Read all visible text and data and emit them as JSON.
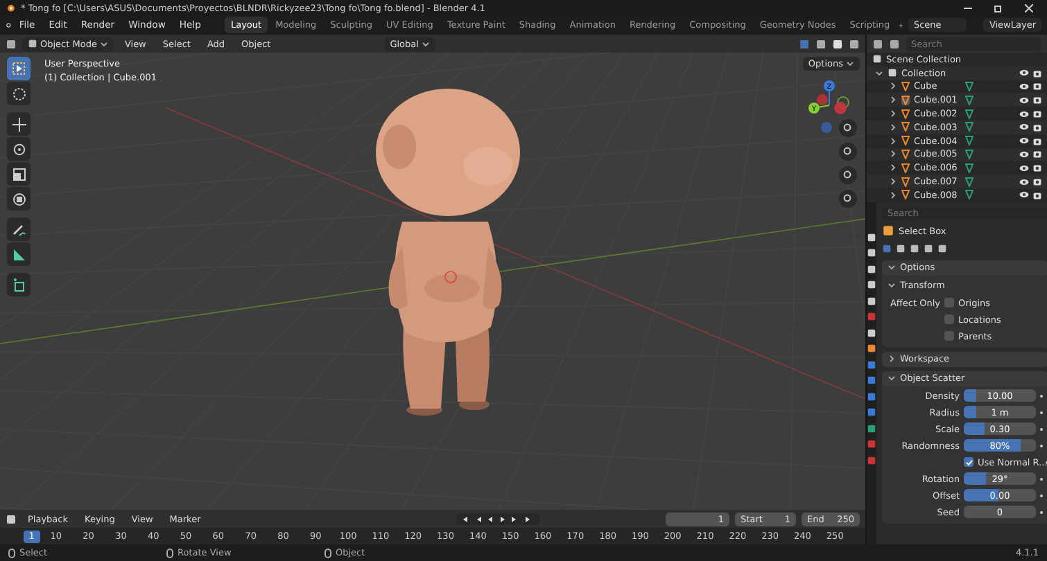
{
  "window": {
    "title": "* Tong fo [C:\\Users\\ASUS\\Documents\\Proyectos\\BLNDR\\Rickyzee23\\Tong fo\\Tong fo.blend] - Blender 4.1"
  },
  "menu": [
    "File",
    "Edit",
    "Render",
    "Window",
    "Help"
  ],
  "workspaces": [
    {
      "label": "Layout",
      "selected": true
    },
    {
      "label": "Modeling",
      "selected": false
    },
    {
      "label": "Sculpting",
      "selected": false
    },
    {
      "label": "UV Editing",
      "selected": false
    },
    {
      "label": "Texture Paint",
      "selected": false
    },
    {
      "label": "Shading",
      "selected": false
    },
    {
      "label": "Animation",
      "selected": false
    },
    {
      "label": "Rendering",
      "selected": false
    },
    {
      "label": "Compositing",
      "selected": false
    },
    {
      "label": "Geometry Nodes",
      "selected": false
    },
    {
      "label": "Scripting",
      "selected": false
    }
  ],
  "scene": "Scene",
  "view_layer": "ViewLayer",
  "viewport_header": {
    "mode": "Object Mode",
    "menus": [
      "View",
      "Select",
      "Add",
      "Object"
    ],
    "orientation": "Global",
    "options": "Options"
  },
  "viewport": {
    "overlay_lines": [
      "User Perspective",
      "(1) Collection | Cube.001"
    ],
    "gizmo_axes": [
      "Z",
      "Y"
    ]
  },
  "outliner": {
    "search_placeholder": "Search",
    "root": "Scene Collection",
    "collection": {
      "name": "Collection",
      "expanded": true,
      "children": [
        {
          "name": "Cube",
          "selected": false
        },
        {
          "name": "Cube.001",
          "selected": true
        },
        {
          "name": "Cube.002",
          "selected": false
        },
        {
          "name": "Cube.003",
          "selected": false
        },
        {
          "name": "Cube.004",
          "selected": false
        },
        {
          "name": "Cube.005",
          "selected": false
        },
        {
          "name": "Cube.006",
          "selected": false
        },
        {
          "name": "Cube.007",
          "selected": false
        },
        {
          "name": "Cube.008",
          "selected": false
        }
      ]
    }
  },
  "properties": {
    "search_placeholder": "Search",
    "tool": "Select Box",
    "options": {
      "title": "Options",
      "expanded": true,
      "transform": {
        "title": "Transform",
        "expanded": true,
        "label": "Affect Only",
        "checkboxes": [
          {
            "label": "Origins",
            "checked": false
          },
          {
            "label": "Locations",
            "checked": false
          },
          {
            "label": "Parents",
            "checked": false
          }
        ]
      }
    },
    "workspace": {
      "title": "Workspace",
      "expanded": false
    },
    "object_scatter": {
      "title": "Object Scatter",
      "expanded": true,
      "fields": [
        {
          "kind": "slider",
          "label": "Density",
          "value": "10.00",
          "level": 0.17
        },
        {
          "kind": "slider",
          "label": "Radius",
          "value": "1 m",
          "level": 0.17
        },
        {
          "kind": "slider",
          "label": "Scale",
          "value": "0.30",
          "level": 0.29
        },
        {
          "kind": "slider",
          "label": "Randomness",
          "value": "80%",
          "level": 0.79
        },
        {
          "kind": "checkbox",
          "label": "Use Normal R...",
          "checked": true
        },
        {
          "kind": "slider",
          "label": "Rotation",
          "value": "29°",
          "level": 0.31
        },
        {
          "kind": "slider",
          "label": "Offset",
          "value": "0.00",
          "level": 0.48
        },
        {
          "kind": "number",
          "label": "Seed",
          "value": "0"
        }
      ]
    }
  },
  "timeline": {
    "menus": [
      "Playback",
      "Keying",
      "View",
      "Marker"
    ],
    "current_frame": "1",
    "start_label": "Start",
    "start": "1",
    "end_label": "End",
    "end": "250",
    "playhead": "1",
    "ticks": [
      "10",
      "20",
      "30",
      "40",
      "50",
      "60",
      "70",
      "80",
      "90",
      "100",
      "110",
      "120",
      "130",
      "140",
      "150",
      "160",
      "170",
      "180",
      "190",
      "200",
      "210",
      "220",
      "230",
      "240",
      "250"
    ]
  },
  "status_bar": {
    "items": [
      "Select",
      "Rotate View",
      "Object"
    ],
    "version": "4.1.1"
  }
}
